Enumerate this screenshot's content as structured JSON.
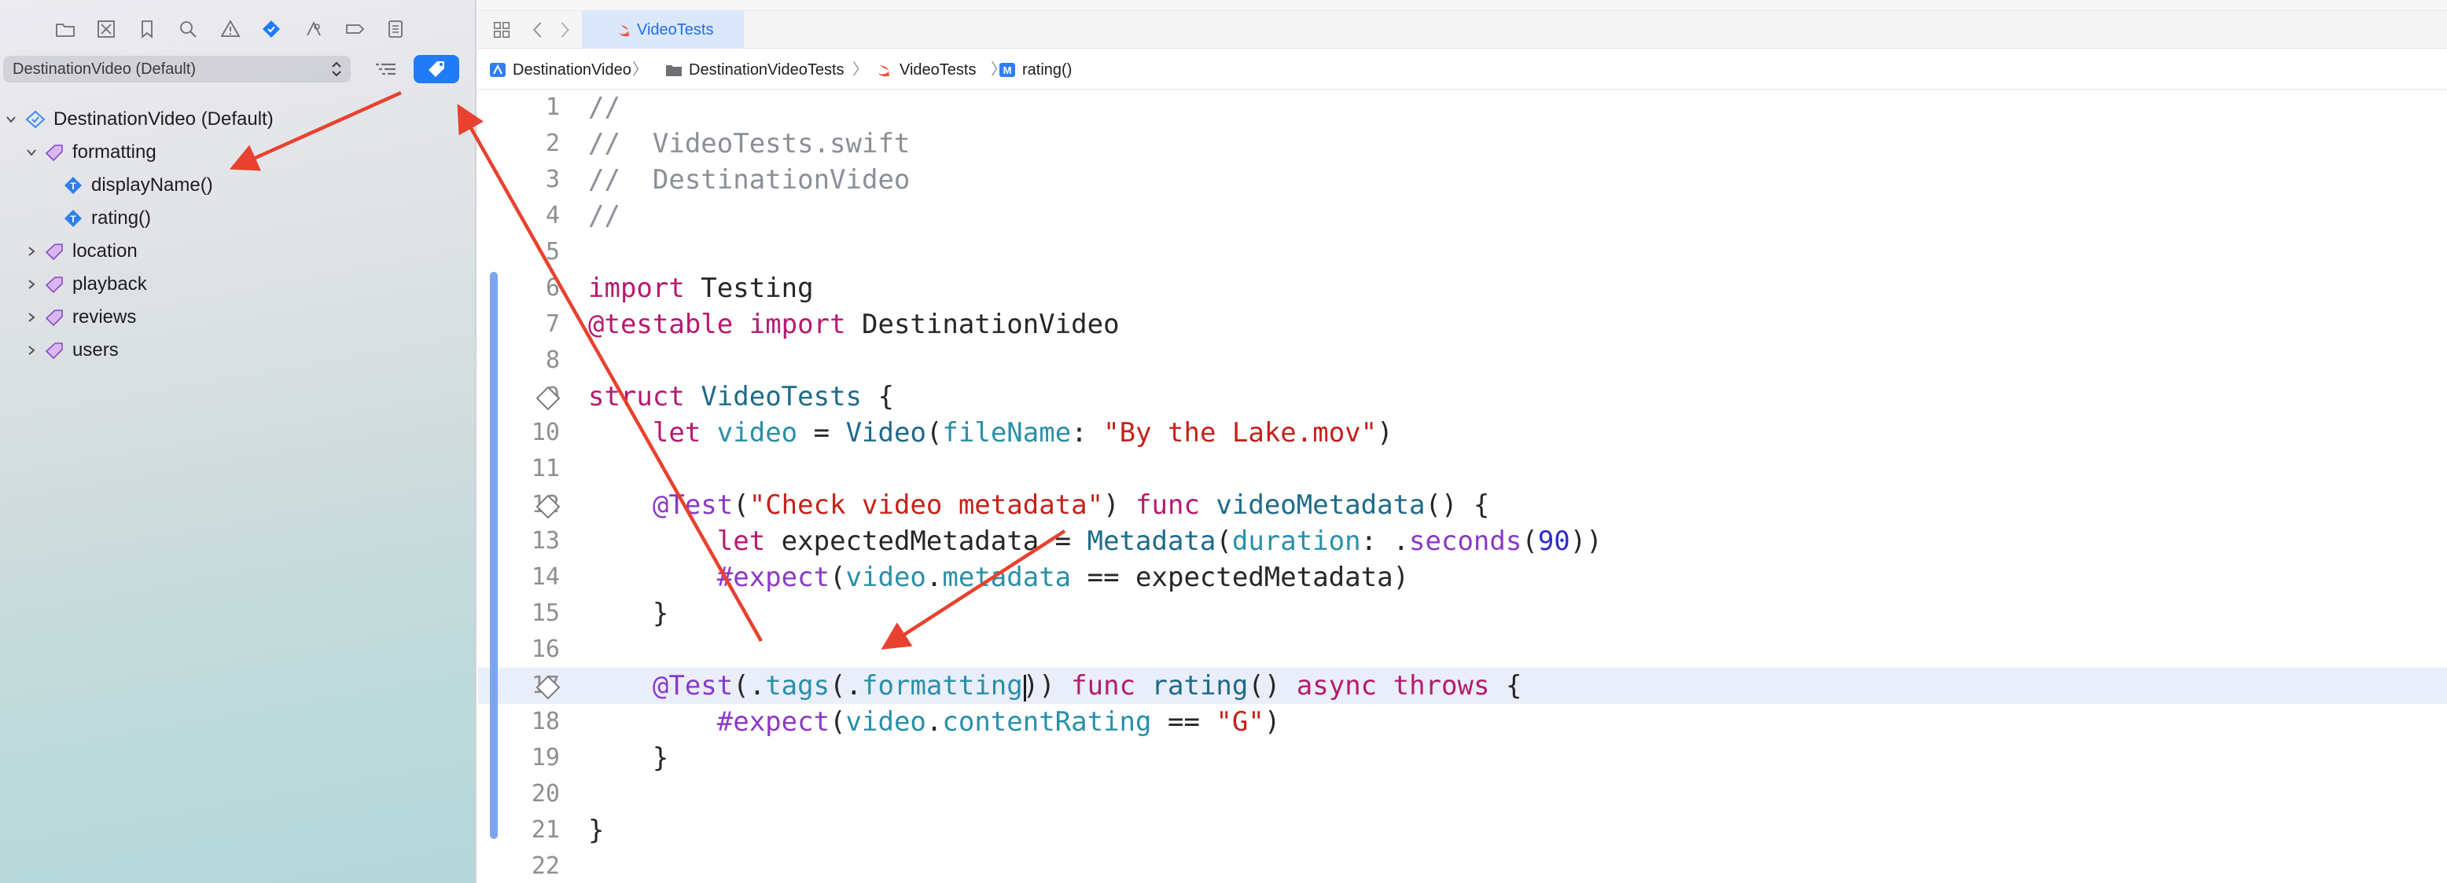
{
  "navigator": {
    "toolbar_icons": [
      "folder-icon",
      "source-control-icon",
      "bookmark-icon",
      "search-icon",
      "warning-icon",
      "test-navigator-icon",
      "debug-icon",
      "breakpoint-icon",
      "report-icon"
    ],
    "scheme": "DestinationVideo (Default)",
    "tree": [
      {
        "label": "DestinationVideo (Default)",
        "kind": "plan",
        "expanded": true
      },
      {
        "label": "formatting",
        "kind": "tag",
        "expanded": true
      },
      {
        "label": "displayName()",
        "kind": "test"
      },
      {
        "label": "rating()",
        "kind": "test"
      },
      {
        "label": "location",
        "kind": "tag",
        "expanded": false
      },
      {
        "label": "playback",
        "kind": "tag",
        "expanded": false
      },
      {
        "label": "reviews",
        "kind": "tag",
        "expanded": false
      },
      {
        "label": "users",
        "kind": "tag",
        "expanded": false
      }
    ]
  },
  "editor": {
    "tab_label": "VideoTests",
    "breadcrumbs": [
      "DestinationVideo",
      "DestinationVideoTests",
      "VideoTests",
      "rating()"
    ],
    "breadcrumb_separator": "〉",
    "current_line": 17,
    "lines": [
      {
        "n": "1",
        "tokens": [
          [
            "com",
            "//"
          ]
        ]
      },
      {
        "n": "2",
        "tokens": [
          [
            "com",
            "//  VideoTests.swift"
          ]
        ]
      },
      {
        "n": "3",
        "tokens": [
          [
            "com",
            "//  DestinationVideo"
          ]
        ]
      },
      {
        "n": "4",
        "tokens": [
          [
            "com",
            "//"
          ]
        ]
      },
      {
        "n": "5",
        "tokens": []
      },
      {
        "n": "6",
        "tokens": [
          [
            "kw",
            "import"
          ],
          [
            "plain",
            " Testing"
          ]
        ]
      },
      {
        "n": "7",
        "tokens": [
          [
            "kw",
            "@testable"
          ],
          [
            "plain",
            " "
          ],
          [
            "kw",
            "import"
          ],
          [
            "plain",
            " DestinationVideo"
          ]
        ]
      },
      {
        "n": "8",
        "tokens": []
      },
      {
        "n": "9",
        "diamond": true,
        "tokens": [
          [
            "kw",
            "struct"
          ],
          [
            "plain",
            " "
          ],
          [
            "type",
            "VideoTests"
          ],
          [
            "plain",
            " {"
          ]
        ]
      },
      {
        "n": "10",
        "tokens": [
          [
            "plain",
            "    "
          ],
          [
            "kw",
            "let"
          ],
          [
            "plain",
            " "
          ],
          [
            "id",
            "video"
          ],
          [
            "plain",
            " = "
          ],
          [
            "type",
            "Video"
          ],
          [
            "plain",
            "("
          ],
          [
            "id",
            "fileName"
          ],
          [
            "plain",
            ": "
          ],
          [
            "str",
            "\"By the Lake.mov\""
          ],
          [
            "plain",
            ")"
          ]
        ]
      },
      {
        "n": "11",
        "tokens": []
      },
      {
        "n": "12",
        "diamond": true,
        "tokens": [
          [
            "plain",
            "    "
          ],
          [
            "mac",
            "@Test"
          ],
          [
            "plain",
            "("
          ],
          [
            "str",
            "\"Check video metadata\""
          ],
          [
            "plain",
            ") "
          ],
          [
            "kw",
            "func"
          ],
          [
            "plain",
            " "
          ],
          [
            "type",
            "videoMetadata"
          ],
          [
            "plain",
            "() {"
          ]
        ]
      },
      {
        "n": "13",
        "tokens": [
          [
            "plain",
            "        "
          ],
          [
            "kw",
            "let"
          ],
          [
            "plain",
            " expectedMetadata = "
          ],
          [
            "type",
            "Metadata"
          ],
          [
            "plain",
            "("
          ],
          [
            "id",
            "duration"
          ],
          [
            "plain",
            ": ."
          ],
          [
            "mac",
            "seconds"
          ],
          [
            "plain",
            "("
          ],
          [
            "num",
            "90"
          ],
          [
            "plain",
            "))"
          ]
        ]
      },
      {
        "n": "14",
        "tokens": [
          [
            "plain",
            "        "
          ],
          [
            "mac",
            "#expect"
          ],
          [
            "plain",
            "("
          ],
          [
            "id",
            "video"
          ],
          [
            "plain",
            "."
          ],
          [
            "id",
            "metadata"
          ],
          [
            "plain",
            " == expectedMetadata)"
          ]
        ]
      },
      {
        "n": "15",
        "tokens": [
          [
            "plain",
            "    }"
          ]
        ]
      },
      {
        "n": "16",
        "tokens": []
      },
      {
        "n": "17",
        "diamond": true,
        "tokens": [
          [
            "plain",
            "    "
          ],
          [
            "mac",
            "@Test"
          ],
          [
            "plain",
            "(."
          ],
          [
            "id",
            "tags"
          ],
          [
            "plain",
            "(."
          ],
          [
            "id",
            "formatting"
          ],
          [
            "plain",
            ")) "
          ],
          [
            "kw",
            "func"
          ],
          [
            "plain",
            " "
          ],
          [
            "type",
            "rating"
          ],
          [
            "plain",
            "() "
          ],
          [
            "kw",
            "async"
          ],
          [
            "plain",
            " "
          ],
          [
            "kw",
            "throws"
          ],
          [
            "plain",
            " {"
          ]
        ]
      },
      {
        "n": "18",
        "tokens": [
          [
            "plain",
            "        "
          ],
          [
            "mac",
            "#expect"
          ],
          [
            "plain",
            "("
          ],
          [
            "id",
            "video"
          ],
          [
            "plain",
            "."
          ],
          [
            "id",
            "contentRating"
          ],
          [
            "plain",
            " == "
          ],
          [
            "str",
            "\"G\""
          ],
          [
            "plain",
            ")"
          ]
        ]
      },
      {
        "n": "19",
        "tokens": [
          [
            "plain",
            "    }"
          ]
        ]
      },
      {
        "n": "20",
        "tokens": []
      },
      {
        "n": "21",
        "tokens": [
          [
            "plain",
            "}"
          ]
        ]
      },
      {
        "n": "22",
        "tokens": []
      }
    ]
  },
  "colors": {
    "accent": "#1f7bf6",
    "annotation_arrow": "#e8412f",
    "keyword": "#b51b6e",
    "string": "#c4221b",
    "comment": "#8a8f98",
    "macro": "#8a3ac6",
    "type": "#1e6a8a",
    "identifier": "#2a8fa8",
    "number": "#2b2bd3"
  }
}
